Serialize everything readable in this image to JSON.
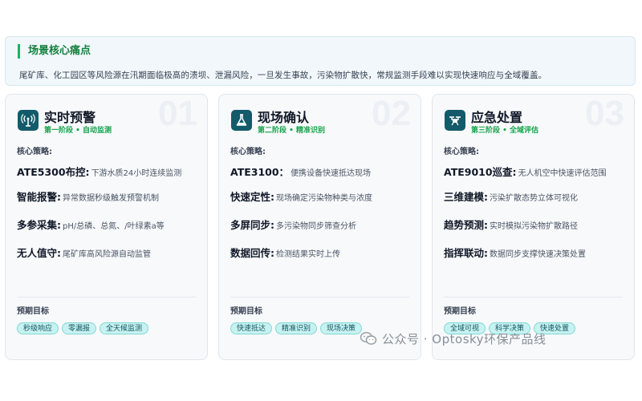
{
  "banner": {
    "title": "场景核心痛点",
    "text": "尾矿库、化工园区等风险源在汛期面临极高的溃坝、泄漏风险，一旦发生事故，污染物扩散快，常规监测手段难以实现快速响应与全域覆盖。"
  },
  "cards": [
    {
      "number": "01",
      "icon": "antenna-signal-icon",
      "title": "实时预警",
      "subtitle": "第一阶段 • 自动监测",
      "core_label": "核心策略:",
      "strategies": [
        {
          "key": "ATE5300布控:",
          "desc": "下游水质24小时连续监测"
        },
        {
          "key": "智能报警:",
          "desc": "异常数据秒级触发预警机制"
        },
        {
          "key": "多参采集:",
          "desc": "pH/总磷、总氮、/叶绿素a等"
        },
        {
          "key": "无人值守:",
          "desc": "尾矿库高风险源自动监管"
        }
      ],
      "goal_label": "预期目标",
      "tags": [
        "秒级响应",
        "零漏报",
        "全天候监测"
      ]
    },
    {
      "number": "02",
      "icon": "flask-icon",
      "title": "现场确认",
      "subtitle": "第二阶段 • 精准识别",
      "core_label": "核心策略:",
      "strategies": [
        {
          "key": "ATE3100：",
          "desc": "便携设备快速抵达现场"
        },
        {
          "key": "快速定性:",
          "desc": "现场确定污染物种类与浓度"
        },
        {
          "key": "多屏同步:",
          "desc": "多污染物同步筛查分析"
        },
        {
          "key": "数据回传:",
          "desc": "检测结果实时上传"
        }
      ],
      "goal_label": "预期目标",
      "tags": [
        "快速抵达",
        "精准识别",
        "现场决策"
      ]
    },
    {
      "number": "03",
      "icon": "drone-icon",
      "title": "应急处置",
      "subtitle": "第三阶段 • 全域评估",
      "core_label": "核心策略:",
      "strategies": [
        {
          "key": "ATE9010巡查:",
          "desc": "无人机空中快速评估范围"
        },
        {
          "key": "三维建模:",
          "desc": "污染扩散态势立体可视化"
        },
        {
          "key": "趋势预测:",
          "desc": "实时模拟污染物扩散路径"
        },
        {
          "key": "指挥联动:",
          "desc": "数据同步支撑快速决策处置"
        }
      ],
      "goal_label": "预期目标",
      "tags": [
        "全域可视",
        "科学决策",
        "快速处置"
      ]
    }
  ],
  "watermark": {
    "text": "公众号 · Optosky环保产品线",
    "icon": "wechat-icon"
  },
  "colors": {
    "accent_green": "#16a34a",
    "icon_bg": "#135a6a",
    "tag_bg": "#c8f2f1"
  }
}
